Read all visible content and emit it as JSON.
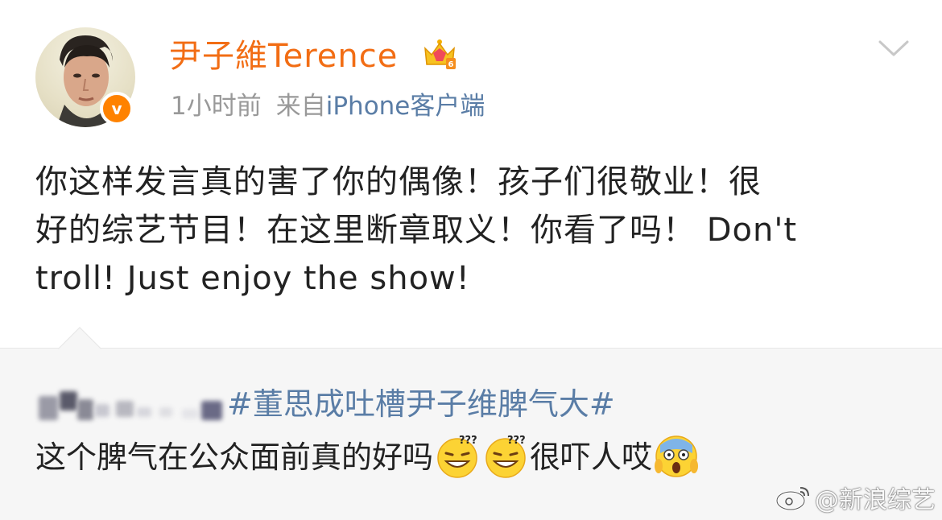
{
  "post": {
    "username": "尹子維Terence",
    "time": "1小时前",
    "from_label": "来自",
    "source": "iPhone客户端",
    "verified_badge": "v",
    "content_lines": [
      "你这样发言真的害了你的偶像！孩子们很敬业！很",
      "好的综艺节目！在这里断章取义！你看了吗！ Don't",
      "troll!  Just enjoy the show!"
    ]
  },
  "repost": {
    "hashtag": "#董思成吐槽尹子维脾气大#",
    "text_before": "这个脾气在公众面前真的好吗",
    "text_middle": "很吓人哎"
  },
  "watermark": {
    "text": "@新浪综艺"
  },
  "icons": {
    "crown": "crown-badge-icon",
    "chevron": "chevron-down-icon",
    "emoji_dizzy": "dizzy-grin-emoji",
    "emoji_scream": "scream-emoji",
    "weibo_logo": "weibo-logo-icon"
  },
  "colors": {
    "username": "#f26d14",
    "link": "#5a7da6",
    "meta": "#999999",
    "repost_bg": "#f6f6f6",
    "verified": "#ff8200"
  }
}
